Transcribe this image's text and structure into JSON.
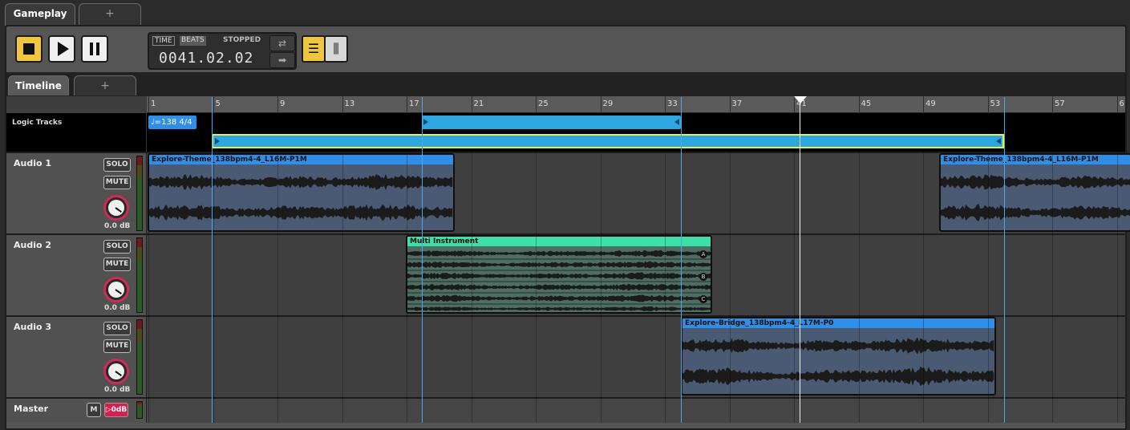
{
  "tabs": {
    "active": "Gameplay",
    "add": "+"
  },
  "transport": {
    "time_label": "TIME",
    "beats_label": "BEATS",
    "status": "STOPPED",
    "position": "0041.02.02",
    "loop_icon": "loop-icon",
    "arrow_icon": "arrow-right-icon"
  },
  "timeline_tabs": {
    "active": "Timeline",
    "add": "+"
  },
  "ruler": {
    "labels": [
      "1",
      "5",
      "9",
      "13",
      "17",
      "21",
      "25",
      "29",
      "33",
      "37",
      "41",
      "45",
      "49",
      "53",
      "57",
      "6"
    ]
  },
  "logic": {
    "label": "Logic Tracks",
    "tempo": "=138 4/4"
  },
  "tracks": [
    {
      "name": "Audio 1",
      "solo": "SOLO",
      "mute": "MUTE",
      "db": "0.0 dB"
    },
    {
      "name": "Audio 2",
      "solo": "SOLO",
      "mute": "MUTE",
      "db": "0.0 dB"
    },
    {
      "name": "Audio 3",
      "solo": "SOLO",
      "mute": "MUTE",
      "db": "0.0 dB"
    }
  ],
  "master": {
    "name": "Master",
    "m": "M",
    "gain": "▷0dB"
  },
  "clips": {
    "audio1_a": "Explore-Theme_138bpm4-4_L16M-P1M",
    "audio1_b": "Explore-Theme_138bpm4-4_L16M-P1M",
    "audio2": "Multi Instrument",
    "audio2_markers": [
      "A",
      "B",
      "C"
    ],
    "audio3": "Explore-Bridge_138bpm4-4_L17M-P0"
  },
  "colors": {
    "accent_yellow": "#f0c640",
    "clip_blue": "#2f8fe8",
    "clip_green": "#3de0a8",
    "knob_ring": "#d02a5a",
    "loop_cyan": "#2ea7e0"
  }
}
